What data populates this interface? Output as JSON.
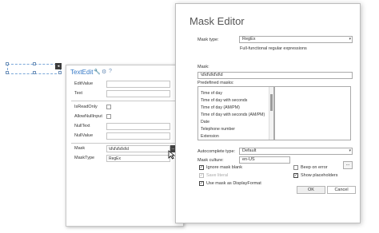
{
  "design_surface": {
    "smart_tag_glyph": "◂"
  },
  "panel": {
    "title": "TextEdit",
    "icons": [
      "wrench-icon",
      "gear-icon",
      "help-icon"
    ],
    "rows": [
      {
        "label": "EditValue",
        "type": "text",
        "value": ""
      },
      {
        "label": "Text",
        "type": "text",
        "value": ""
      },
      {
        "label": "IsReadOnly",
        "type": "check"
      },
      {
        "label": "AllowNullInput",
        "type": "check"
      },
      {
        "label": "NullText",
        "type": "text",
        "value": ""
      },
      {
        "label": "NullValue",
        "type": "text",
        "value": ""
      },
      {
        "label": "Mask",
        "type": "text",
        "value": "\\d\\d\\d\\d\\d\\d"
      },
      {
        "label": "MaskType",
        "type": "text",
        "value": "RegEx"
      }
    ],
    "mask_button_label": "...",
    "colors": {
      "title": "#3478c6"
    }
  },
  "dialog": {
    "title": "Mask Editor",
    "mask_type_label": "Mask type:",
    "mask_type_value": "RegEx",
    "mask_type_desc": "Full-functional regular expressions",
    "mask_label": "Mask:",
    "mask_value": "\\d\\d\\d\\d\\d\\d",
    "predefined_label": "Predefined masks:",
    "masks": [
      "Time of day",
      "Time of day with seconds",
      "Time of day (AM/PM)",
      "Time of day with seconds (AM/PM)",
      "Date",
      "Telephone number",
      "Extension"
    ],
    "autocomplete_label": "Autocomplete type:",
    "autocomplete_value": "Default",
    "culture_label": "Mask culture:",
    "culture_value": "en-US",
    "checks": {
      "ignore_blank": {
        "label": "Ignore mask blank",
        "checked": true
      },
      "save_literal": {
        "label": "Save literal",
        "checked": true,
        "disabled": true
      },
      "use_display": {
        "label": "Use mask as DisplayFormat",
        "checked": true
      },
      "beep": {
        "label": "Beep on error",
        "checked": false
      },
      "show_placeholders": {
        "label": "Show placeholders",
        "checked": true
      }
    },
    "ellipsis_label": "...",
    "ok_label": "OK",
    "cancel_label": "Cancel"
  }
}
